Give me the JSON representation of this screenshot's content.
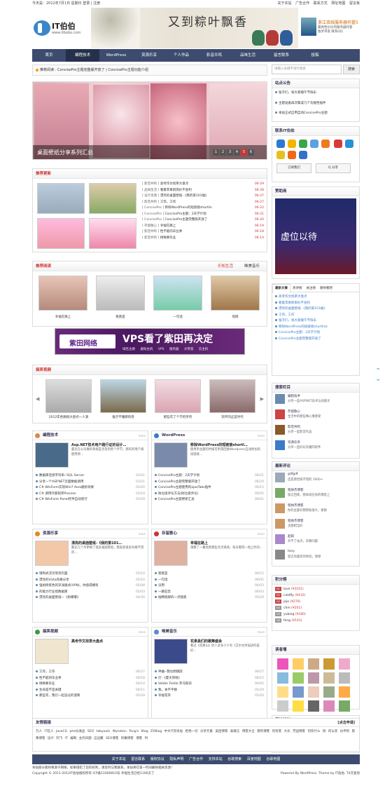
{
  "topbar": {
    "date": "今天是：2012年7月1日 星期日",
    "login": "登录",
    "register": "注册",
    "links": [
      "关于本站",
      "广告合作",
      "联系方式",
      "网址地图",
      "留言板"
    ]
  },
  "logo": {
    "name": "IT伯伯",
    "url": "www.itbobo.com"
  },
  "banner": {
    "title": "又到粽叶飘香"
  },
  "ad": {
    "title": "浙江双线服务器托管5",
    "line1": "最具性价比的服务器托管",
    "line2": "独享带宽 联系QQ"
  },
  "nav": [
    "首页",
    "编程技术",
    "WordPress",
    "资源乐享",
    "个人作品",
    "影音共鸣",
    "品味生活",
    "留言联系",
    "投稿"
  ],
  "notice": {
    "label": "推荐阅读：",
    "text": "ConcisePro主题完整版开放了  |  ConcisePro主题功能介绍"
  },
  "slider": {
    "caption": "桌面壁纸分享系列汇总",
    "pages": [
      "1",
      "2",
      "3",
      "4",
      "5",
      "6"
    ],
    "active": "5"
  },
  "recommend": {
    "title": "推荐更新",
    "rows": [
      {
        "cat": "[ 影音共鸣 ]",
        "t": "高考作文找茶大盘点",
        "d": "06-29"
      },
      {
        "cat": "[ 品味生活 ]",
        "t": "看看苹果新雨衫不会利",
        "d": "06-28"
      },
      {
        "cat": "[ 设计资源 ]",
        "t": "漂亮的桌面壁纸-《我的第101幅》",
        "d": "06-27"
      },
      {
        "cat": "[ 影音共鸣 ]",
        "t": "工作，工作",
        "d": "06-27"
      },
      {
        "cat": "[ ConcisePro ]",
        "t": "移除WordPress的短链接shortlin",
        "d": "06-22"
      },
      {
        "cat": "[ ConcisePro ]",
        "t": "ConcisePro主题：2天学计划",
        "d": "06-21"
      },
      {
        "cat": "[ ConcisePro ]",
        "t": "ConcisePro主题完整版开放了",
        "d": "06-20"
      },
      {
        "cat": "[ 存留散心 ]",
        "t": "幸福在路上",
        "d": "06-19"
      },
      {
        "cat": "[ 影音共鸣 ]",
        "t": "性不能的毕业季",
        "d": "06-18"
      },
      {
        "cat": "[ 影音共鸣 ]",
        "t": "杨梅要毕业",
        "d": "06-14"
      }
    ]
  },
  "reading": {
    "title": "推荐阅读",
    "tab1": "乐知生活",
    "tab2": "唯美音乐",
    "items": [
      "幸福在路上",
      "爸爸是",
      "一句话",
      "现摇"
    ]
  },
  "vps": {
    "brand": "紫田网络",
    "headline": "VPS看了紫田再决定",
    "sub": "域名注册 虚拟主机 VPS 服务器 大带宽 云主机"
  },
  "funny": {
    "title": "搞笑视频",
    "items": [
      "2012年各路搞大盘点一人演",
      "猴子不懂那的卷",
      "那些年了个学的罗月",
      "玩坏的这首时代"
    ]
  },
  "cols": [
    {
      "title": "编程技术",
      "ft": "Asp.NET技术用户路行证的设计…",
      "fd": "最近在公司做的系统是涉及到各个环节。那有的用户调使用原…",
      "rows": [
        [
          "数据库连接字符串--SQL Server",
          "03/21"
        ],
        [
          "分享一个ASP.NET页面数据调用",
          "03/21"
        ],
        [
          "C# WinForm实现Win7 Aero磨砂效果",
          "03/20"
        ],
        [
          "C# 调用外部程序Process",
          "03/19"
        ],
        [
          "C# WinForm Panel控件自动装行",
          "02/29"
        ]
      ]
    },
    {
      "title": "WordPress",
      "ft": "移除WordPress的短链接shortl…",
      "fd": "使用单主题的时候可用来回收Wordpress自动附加的短链接…",
      "rows": [
        [
          "ConcisePro主题：2天学计划",
          "06/21"
        ],
        [
          "ConcisePro主题完整版开放了",
          "06/20"
        ],
        [
          "ConcisePro主题使用的ajaxTabs插件",
          "06/15"
        ],
        [
          "防垃圾评论方法(防垃圾评论)",
          "06/05"
        ],
        [
          "ConcisePro主题更新汇总",
          "06/01"
        ]
      ]
    },
    {
      "title": "资源乐享",
      "ft": "漂亮的桌面壁纸-《我的第101…",
      "fd": "最近几个月更换了很多桌面壁纸，我发现很多风格不错的…",
      "rows": [
        [
          "增和式浮页等到页面",
          "05/10"
        ],
        [
          "漂亮的Vista风格分享",
          "05/10"
        ],
        [
          "强如修炼色的深浅版式(VPN)，你值得拥有",
          "05/08"
        ],
        [
          "的能力行业搭数据库",
          "05/03"
        ],
        [
          "漂亮的桌面壁纸—《粉嘟嘟》",
          "04/30"
        ]
      ]
    },
    {
      "title": "存留散心",
      "ft": "幸福在路上",
      "fd": "请教了一番高原那些点点滴滴，每天看得一地上时间…",
      "rows": [
        [
          "爸爸是",
          "06/15"
        ],
        [
          "一句话",
          "06/05"
        ],
        [
          "没用",
          "06/03"
        ],
        [
          "一路狂奔",
          "06/03"
        ],
        [
          "拍精锐那的一点随意",
          "05/29"
        ]
      ]
    },
    {
      "title": "搞笑视频",
      "ft": "高考作文找茶大盘点",
      "fd": "",
      "rows": [
        [
          "工作，工作",
          "06/27"
        ],
        [
          "性不能的毕业季",
          "06/18"
        ],
        [
          "杨梅要毕业",
          "06/14"
        ],
        [
          "生命是不是关键",
          "06/11"
        ],
        [
          "那些年，我们一起追过的酒和",
          "05/29"
        ]
      ]
    },
    {
      "title": "唯美音乐",
      "ft": "花果县们的歌舞盛会",
      "fd": "看过《花果山》的人多多少少有《艾尔文所描述的美好…",
      "rows": [
        [
          "神曲--我也想跳跃",
          "06/27"
        ],
        [
          "灯-《夏天到啦》",
          "06/15"
        ],
        [
          "Valder Fields-罗马假日",
          "06/05"
        ],
        [
          "我，本不平静",
          "05/29"
        ],
        [
          "幸福花开",
          "05/20"
        ]
      ]
    }
  ],
  "side": {
    "search": {
      "placeholder": "请输入关键字进行搜索",
      "button": "搜索"
    },
    "announce": {
      "title": "站点公告",
      "rows": [
        "留子们，祝大家端午节快乐",
        "主题准备再次集成几个功能性插件",
        "本站正式启用自动ConcisePro主题"
      ]
    },
    "contact": {
      "title": "联系IT伯伯",
      "bookmark": "订阅我们",
      "share": "Q 分享"
    },
    "sponsor": {
      "title": "赞助商",
      "text": "虚位以待"
    },
    "tabs": {
      "labels": [
        "最新文章",
        "热评榜",
        "关注榜",
        "随你看吧"
      ],
      "rows": [
        "高考作文找茶大盘点",
        "看着苹果新雨衫不会利",
        "漂亮的桌面壁纸-《我的第101幅》",
        "工作，工作",
        "留子们，祝大家端午节快乐",
        "移除WordPress的短链接shortlink",
        "ConcisePro主题：2天学计划",
        "ConcisePro主题完整版开放了"
      ]
    },
    "cats": {
      "title": "搜索栏目",
      "items": [
        [
          "编程技术",
          "分享一些ASP.NET技术与技能文"
        ],
        [
          "存留散心",
          "生活中的那些事心情感受"
        ],
        [
          "影音共鸣",
          "分享一些影音作品"
        ],
        [
          "资源乐享",
          "分享一些好玩有趣的软件"
        ]
      ]
    },
    "comments": {
      "title": "最新评论",
      "items": [
        [
          "gdfgdf",
          "还是感觉很不错的 1000+"
        ],
        [
          "程帅杰博客",
          "留言回来，我本就在你的博客上"
        ],
        [
          "程帅杰博客",
          "你的主题对我帮助很大，谢谢"
        ],
        [
          "程帅杰博客",
          "主题相当好"
        ],
        [
          "起碎",
          "开不了站点，求教问题"
        ],
        [
          "tony",
          "留言你喜欢的体验，谢谢"
        ]
      ]
    },
    "score": {
      "title": "积分榜",
      "rows": [
        [
          "love",
          "¥3101"
        ],
        [
          "coldfly",
          "¥410"
        ],
        [
          "jojo",
          "¥276"
        ],
        [
          "chm",
          "¥201"
        ],
        [
          "yubing",
          "¥180"
        ],
        [
          "feng",
          "¥143"
        ]
      ]
    },
    "readers": {
      "title": "读者墙"
    },
    "stats": {
      "title": "网站统计",
      "rows": [
        [
          "日志总数：379篇",
          "评论总数：2813条"
        ],
        [
          "分类总数：25个",
          "标签总数：1303个"
        ],
        [
          "友情链接：40个",
          "网站运行：274天"
        ],
        [
          "最后更新：2012年6月29日",
          ""
        ]
      ]
    }
  },
  "friends": {
    "title": "友情链接",
    "apply": "[点击申请]",
    "links": "凡人  IT狂人  JavaCG  phe伙收品  SEO  tabyouts  Wynetan  Tong's Blog  ZXBlog  中文IT资讯站  拒绝一切  分享元素  美团博客  泰微言  博客大全  期刊博客  何有客  大乐  芳园博客  何有什么  悦  何以欢 伙伴的 影像博客 设计 阿飞  IT 编制  主的问题  这边聚  SEO博客  阿幕博客  博客 时"
  },
  "footer": {
    "links": [
      "关于本站",
      "留言联系",
      "版权协议",
      "隐私声明",
      "广告合作",
      "支持本站",
      "谷歌搜索",
      "百度地图",
      "谷歌地图"
    ],
    "line1": "本站部分素材来源于网络，如果侵犯了您的权利，请及时与我联系，本站将在第一时间删除相关资源！",
    "line2": "Copyright © 2011-2012IT伯伯版权所有 ICP备11000810号 幸福生活已经1106天了",
    "power": "Powered By WordPress. Theme by IT伯伯. T4次查询"
  }
}
